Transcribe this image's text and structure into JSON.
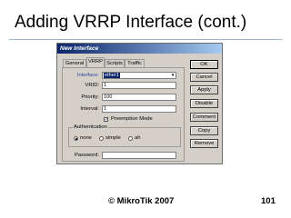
{
  "slide": {
    "title": "Adding VRRP Interface (cont.)",
    "footer": "© MikroTik 2007",
    "page_number": "101",
    "accent_color": "#9db4d8"
  },
  "dialog": {
    "title": "New Interface",
    "tabs": [
      {
        "label": "General",
        "active": false
      },
      {
        "label": "VRRP",
        "active": true
      },
      {
        "label": "Scripts",
        "active": false
      },
      {
        "label": "Traffic",
        "active": false
      }
    ],
    "fields": {
      "interface": {
        "label": "Interface:",
        "value": "ether1"
      },
      "vrid": {
        "label": "VRID:",
        "value": "1"
      },
      "priority": {
        "label": "Priority:",
        "value": "100"
      },
      "interval": {
        "label": "Interval:",
        "value": "1"
      },
      "password": {
        "label": "Password:",
        "value": ""
      }
    },
    "preemption": {
      "label": "Preemption Mode",
      "checked": true
    },
    "authentication": {
      "title": "Authentication",
      "options": [
        {
          "label": "none",
          "selected": true
        },
        {
          "label": "simple",
          "selected": false
        },
        {
          "label": "ah",
          "selected": false
        }
      ]
    },
    "buttons": {
      "ok": "OK",
      "cancel": "Cancel",
      "apply": "Apply",
      "disable": "Disable",
      "comment": "Comment",
      "copy": "Copy",
      "remove": "Remove"
    },
    "titlebar_colors": {
      "start": "#0a246a",
      "end": "#a6caf0"
    },
    "face_color": "#d4d0c8"
  }
}
